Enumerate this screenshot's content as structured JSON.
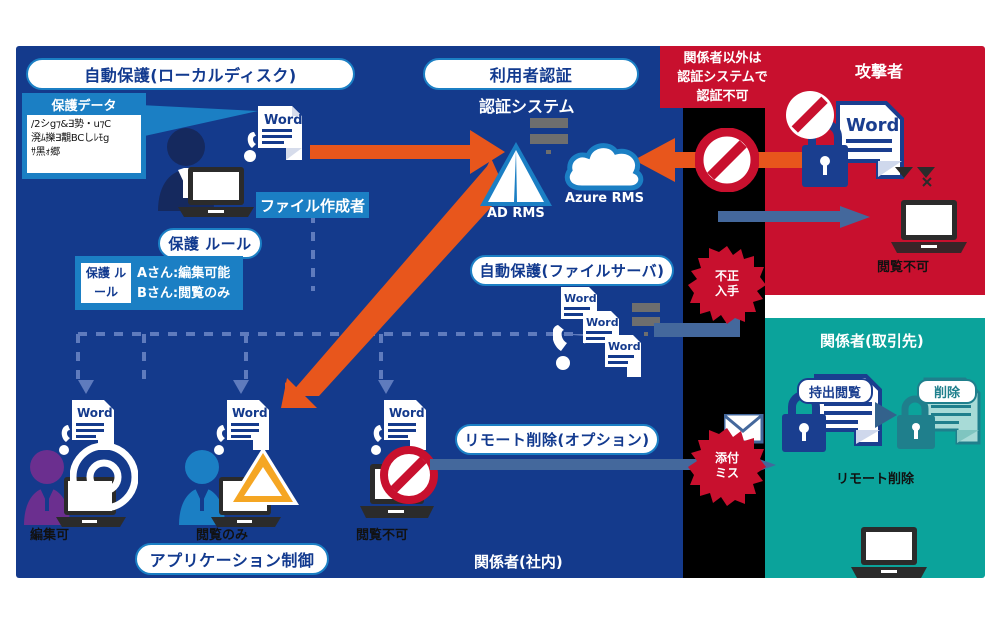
{
  "regions": {
    "internal": {
      "label": "関係者(社内)",
      "color": "#143a8c"
    },
    "corridor": {
      "color": "#000000"
    },
    "attacker": {
      "label": "攻撃者",
      "color": "#c8102e"
    },
    "partner": {
      "label": "関係者(取引先)",
      "color": "#0ba39b"
    }
  },
  "pills": {
    "auto_protect_local": "自動保護(ローカルディスク)",
    "user_auth": "利用者認証",
    "protection_rule": "保護 ルール",
    "auto_protect_fileserver": "自動保護(ファイルサーバ)",
    "remote_delete_option": "リモート削除(オプション)",
    "application_control": "アプリケーション制御"
  },
  "tags": {
    "file_creator": "ファイル作成者"
  },
  "protected_data": {
    "title": "保護データ",
    "cipher": "/2シg⁊&∃㔟・u⁊C\n溌ﾑ擽∃覯BCしﾚﾓg\nｻ黑ｫ郷"
  },
  "rule_box": {
    "chip": "保護\nルール",
    "lines": "Aさん:編集可能\nBさん:閲覧のみ"
  },
  "auth_system": {
    "title": "認証システム",
    "ad_rms": "AD RMS",
    "azure_rms": "Azure RMS"
  },
  "attacker": {
    "warning": "関係者以外は\n認証システムで\n認証不可",
    "no_view": "閲覧不可"
  },
  "bursts": {
    "illegal_acquisition": "不正\n入手",
    "attachment_mistake": "添付\nミス"
  },
  "internal_users": [
    {
      "label": "編集可",
      "status_icon": "circle-ok-icon",
      "doc": "Word",
      "person_color": "#6b2f8f"
    },
    {
      "label": "閲覧のみ",
      "status_icon": "warning-triangle-icon",
      "doc": "Word",
      "person_color": "#1b7fc4"
    },
    {
      "label": "閲覧不可",
      "status_icon": "prohibited-icon",
      "doc": "Word"
    }
  ],
  "fileserver": {
    "docs": [
      "Word",
      "Word",
      "Word"
    ]
  },
  "partner": {
    "doc_takeout": "持出閲覧",
    "doc_deleted": "削除",
    "remote_delete": "リモート削除"
  },
  "docs": {
    "word_label": "Word"
  },
  "colors": {
    "navy": "#143a8c",
    "blue_accent": "#1b7fc4",
    "red": "#c8102e",
    "teal": "#0ba39b",
    "orange": "#e8561c",
    "steel_arrow": "#44689c",
    "amber": "#f5a623",
    "black": "#000000"
  }
}
